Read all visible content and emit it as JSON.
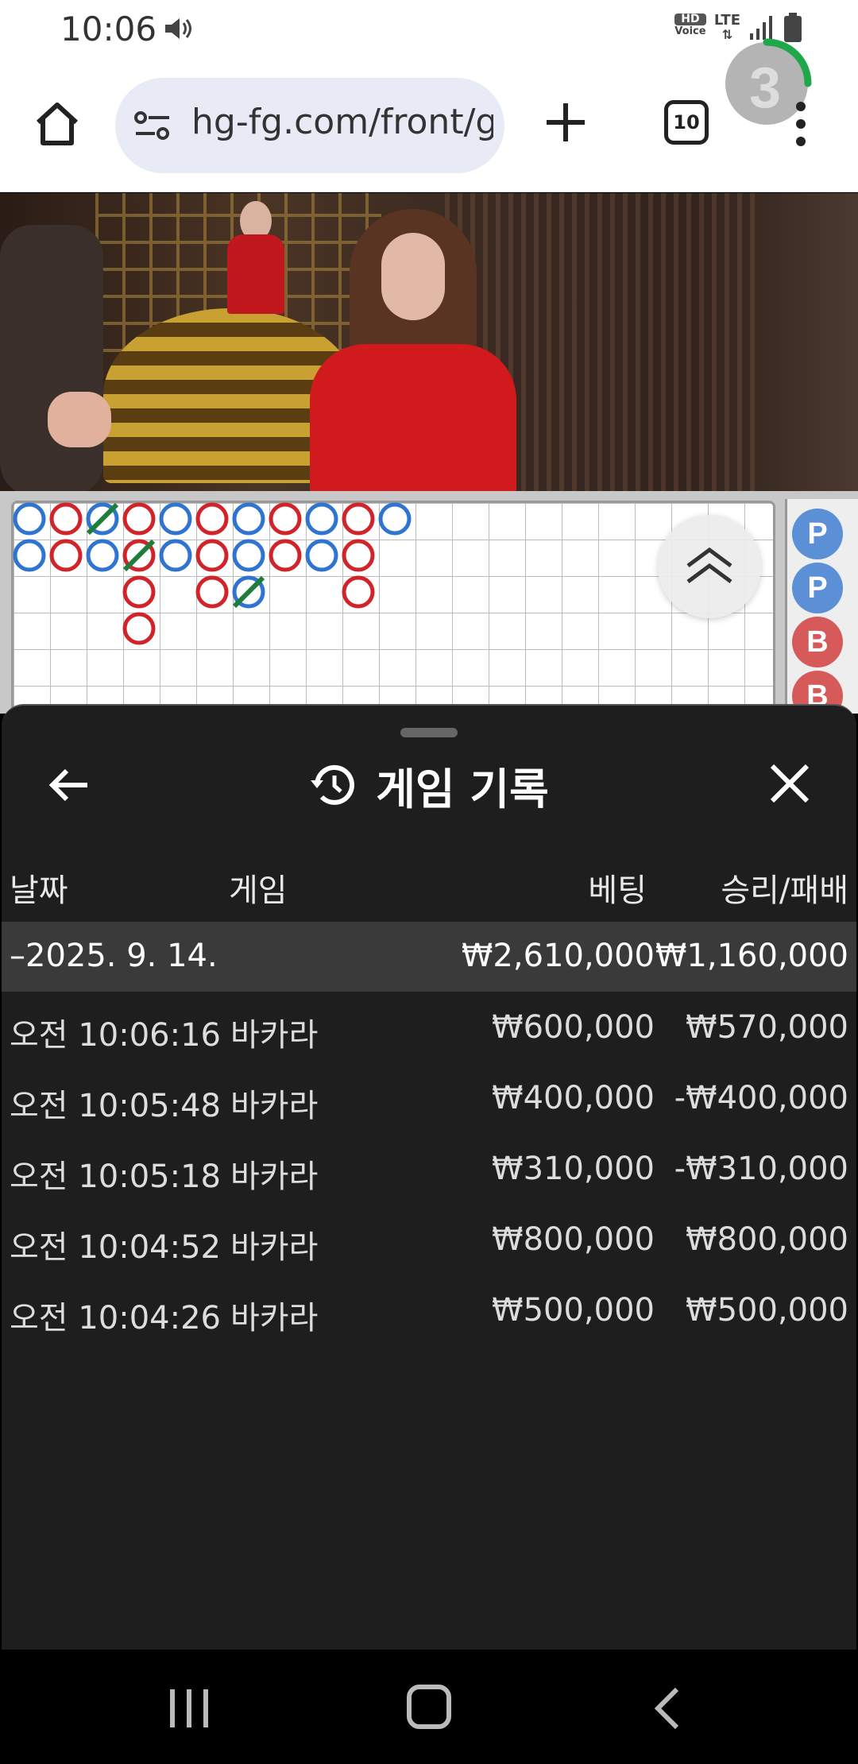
{
  "status_bar": {
    "time": "10:06",
    "hd_line1": "HD",
    "hd_line2": "Voice",
    "network": "LTE",
    "icons": [
      "sound-icon",
      "signal-icon",
      "battery-icon"
    ]
  },
  "browser": {
    "url": "hg-fg.com/front/g",
    "tab_count": "10",
    "icons": [
      "home-icon",
      "tune-icon",
      "plus-icon",
      "more-vert-icon"
    ]
  },
  "video": {
    "countdown": "3",
    "countdown_fraction": 0.25,
    "accent": "#1fa84a"
  },
  "roadmap": {
    "colors": {
      "player": "#2f74d0",
      "banker": "#d0242a",
      "tie": "#1e7d3a"
    },
    "side_beads": [
      "P",
      "P",
      "B",
      "B"
    ]
  },
  "sheet": {
    "title": "게임 기록",
    "icons": [
      "back-arrow-icon",
      "history-icon",
      "close-icon"
    ],
    "columns": {
      "date": "날짜",
      "game": "게임",
      "bet": "베팅",
      "win_loss": "승리/패배"
    },
    "date_group": {
      "label": "–2025. 9. 14.",
      "bet": "₩2,610,000",
      "win_loss": "₩1,160,000"
    },
    "records": [
      {
        "time": "오전 10:06:16",
        "game": "바카라",
        "bet": "₩600,000",
        "win_loss": "₩570,000"
      },
      {
        "time": "오전 10:05:48",
        "game": "바카라",
        "bet": "₩400,000",
        "win_loss": "-₩400,000"
      },
      {
        "time": "오전 10:05:18",
        "game": "바카라",
        "bet": "₩310,000",
        "win_loss": "-₩310,000"
      },
      {
        "time": "오전 10:04:52",
        "game": "바카라",
        "bet": "₩800,000",
        "win_loss": "₩800,000"
      },
      {
        "time": "오전 10:04:26",
        "game": "바카라",
        "bet": "₩500,000",
        "win_loss": "₩500,000"
      }
    ]
  },
  "navbar": {
    "icons": [
      "recents-icon",
      "home-nav-icon",
      "back-nav-icon"
    ]
  }
}
